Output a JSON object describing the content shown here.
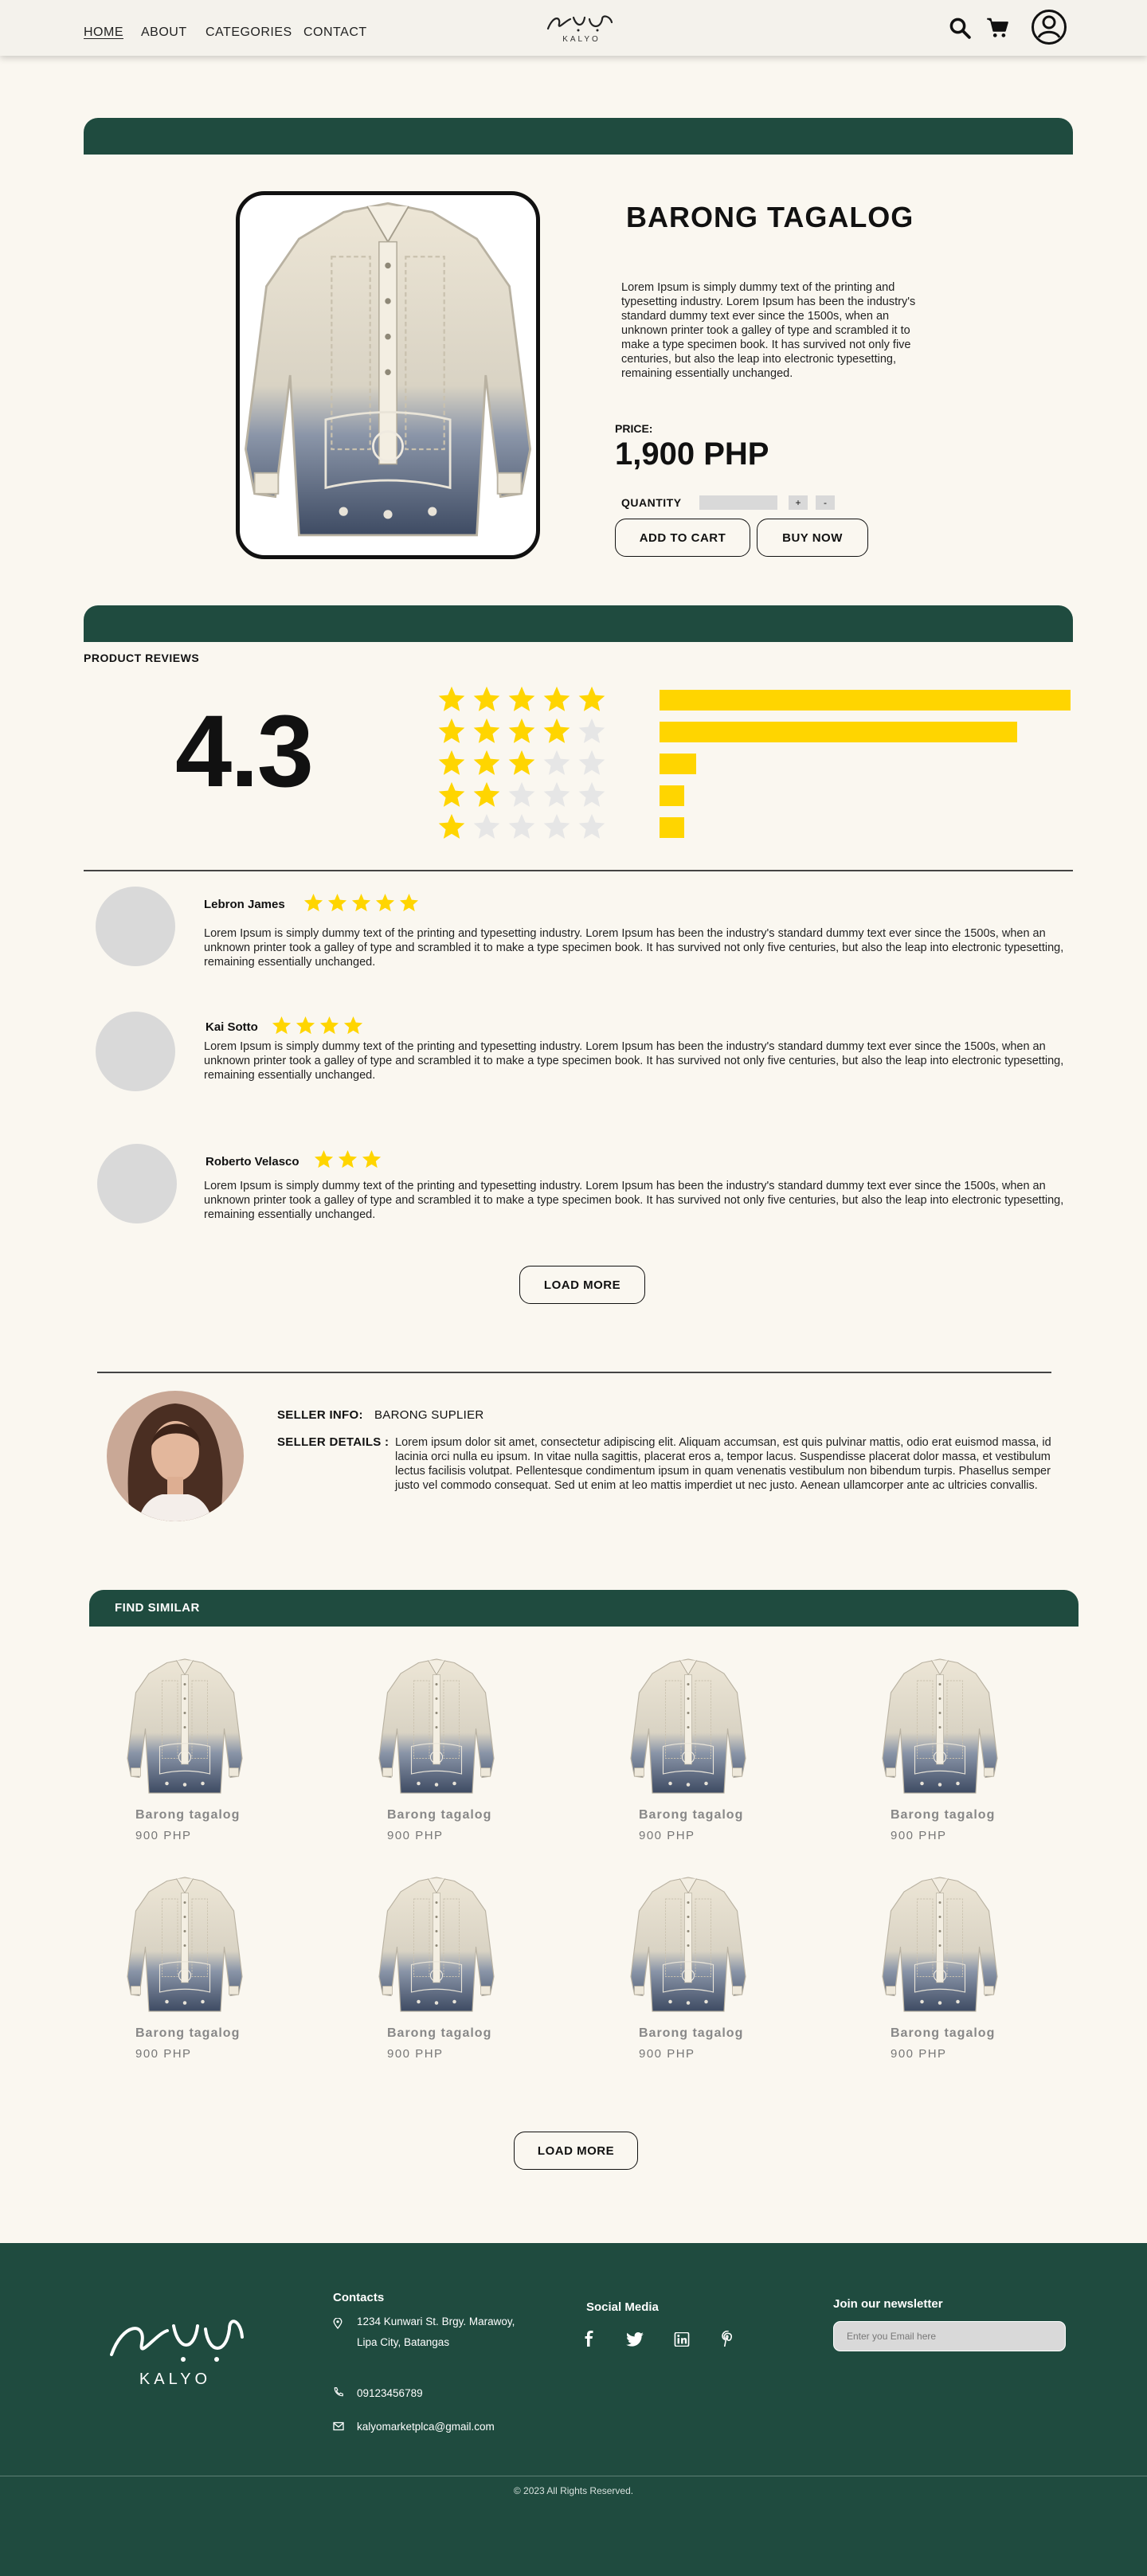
{
  "nav": {
    "home": "HOME",
    "about": "ABOUT",
    "categories": "CATEGORIES",
    "contact": "CONTACT",
    "logo_text": "KALYO",
    "icons": [
      "search-icon",
      "cart-icon",
      "user-icon"
    ]
  },
  "product": {
    "title": "BARONG TAGALOG",
    "description": "Lorem Ipsum is simply dummy text of the printing and typesetting industry. Lorem Ipsum has been the industry's standard dummy text ever since the 1500s, when an unknown printer took a galley of type and scrambled it to make a type specimen book. It has survived not only five centuries, but also the leap into electronic typesetting, remaining essentially unchanged.",
    "price_label": "PRICE:",
    "price": "1,900 PHP",
    "quantity_label": "QUANTITY",
    "plus": "+",
    "minus": "-",
    "add_to_cart": "ADD TO CART",
    "buy_now": "BUY NOW"
  },
  "reviews": {
    "section_title": "PRODUCT REVIEWS",
    "average": "4.3",
    "distribution": [
      {
        "stars": 5,
        "fraction": 1.0
      },
      {
        "stars": 4,
        "fraction": 0.87
      },
      {
        "stars": 3,
        "fraction": 0.09
      },
      {
        "stars": 2,
        "fraction": 0.06
      },
      {
        "stars": 1,
        "fraction": 0.06
      }
    ],
    "items": [
      {
        "name": "Lebron James",
        "stars": 5,
        "text": "Lorem Ipsum is simply dummy text of the printing and typesetting industry. Lorem Ipsum has been the industry's standard dummy text ever since the 1500s, when an unknown printer took a galley of type and scrambled it to make a type specimen book. It has survived not only five centuries, but also the leap into electronic typesetting, remaining essentially unchanged."
      },
      {
        "name": "Kai Sotto",
        "stars": 4,
        "text": "Lorem Ipsum is simply dummy text of the printing and typesetting industry. Lorem Ipsum has been the industry's standard dummy text ever since the 1500s, when an unknown printer took a galley of type and scrambled it to make a type specimen book. It has survived not only five centuries, but also the leap into electronic typesetting, remaining essentially unchanged."
      },
      {
        "name": "Roberto Velasco",
        "stars": 3,
        "text": "Lorem Ipsum is simply dummy text of the printing and typesetting industry. Lorem Ipsum has been the industry's standard dummy text ever since the 1500s, when an unknown printer took a galley of type and scrambled it to make a type specimen book. It has survived not only five centuries, but also the leap into electronic typesetting, remaining essentially unchanged."
      }
    ],
    "load_more": "LOAD MORE",
    "star_color": "#FFD500",
    "empty_star_color": "#E6E6E6"
  },
  "seller": {
    "info_label": "SELLER INFO:",
    "info_value": "BARONG SUPLIER",
    "details_label": "SELLER DETAILS :",
    "details": "Lorem ipsum dolor sit amet, consectetur adipiscing elit. Aliquam accumsan, est quis pulvinar mattis, odio erat euismod massa, id lacinia orci nulla eu ipsum. In vitae nulla sagittis, placerat eros a, tempor lacus. Suspendisse placerat dolor massa, et vestibulum lectus facilisis volutpat. Pellentesque condimentum ipsum in quam venenatis vestibulum non bibendum turpis. Phasellus semper justo vel commodo consequat. Sed ut enim at leo mattis imperdiet ut nec justo. Aenean ullamcorper ante ac ultricies convallis."
  },
  "similar": {
    "title": "FIND SIMILAR",
    "items": [
      {
        "name": "Barong tagalog",
        "price": "900 PHP"
      },
      {
        "name": "Barong tagalog",
        "price": "900 PHP"
      },
      {
        "name": "Barong tagalog",
        "price": "900 PHP"
      },
      {
        "name": "Barong tagalog",
        "price": "900 PHP"
      },
      {
        "name": "Barong tagalog",
        "price": "900 PHP"
      },
      {
        "name": "Barong tagalog",
        "price": "900 PHP"
      },
      {
        "name": "Barong tagalog",
        "price": "900 PHP"
      },
      {
        "name": "Barong tagalog",
        "price": "900 PHP"
      }
    ],
    "load_more": "LOAD MORE"
  },
  "footer": {
    "logo_text": "KALYO",
    "contacts_title": "Contacts",
    "address_line1": "1234 Kunwari St. Brgy. Marawoy,",
    "address_line2": "Lipa City, Batangas",
    "phone": "09123456789",
    "email": "kalyomarketplca@gmail.com",
    "social_title": "Social Media",
    "social_icons": [
      "facebook-icon",
      "twitter-icon",
      "linkedin-icon",
      "pinterest-icon"
    ],
    "newsletter_title": "Join our newsletter",
    "newsletter_placeholder": "Enter you Email here",
    "copyright": "© 2023 All Rights Reserved."
  },
  "colors": {
    "brand_green": "#1F4B3F",
    "background": "#FAF7F0",
    "accent_yellow": "#FFD500"
  }
}
